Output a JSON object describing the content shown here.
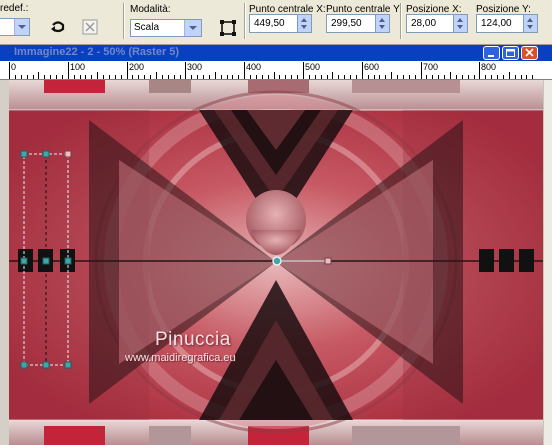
{
  "toolbar": {
    "preset_label": "redef.:",
    "mode_label": "Modalità:",
    "mode_value": "Scala",
    "center_x_label": "Punto centrale X:",
    "center_x_value": "449,50",
    "center_y_label": "Punto centrale Y:",
    "center_y_value": "299,50",
    "pos_x_label": "Posizione X:",
    "pos_x_value": "28,00",
    "pos_y_label": "Posizione Y:",
    "pos_y_value": "124,00",
    "icons": [
      "reset-icon",
      "object-icon",
      "fit-to-canvas-icon"
    ]
  },
  "window": {
    "title": "Immagine22 - 2 - 50% (Raster 5)",
    "buttons": [
      "minimize-icon",
      "maximize-icon",
      "close-icon"
    ]
  },
  "ruler": {
    "labels": [
      "0",
      "100",
      "200",
      "300",
      "400",
      "500",
      "600",
      "700",
      "800"
    ]
  },
  "canvas": {
    "watermark_name": "Pinuccia",
    "watermark_url": "www.maidiregrafica.eu",
    "colors": {
      "crimson": "#c4243a",
      "rose": "#c85d66",
      "dark": "#1a0d0f",
      "handle": "#3fa7a8"
    }
  }
}
